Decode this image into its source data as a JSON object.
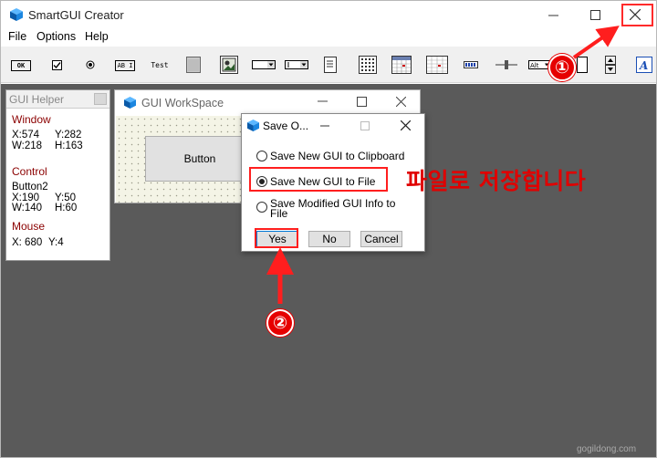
{
  "app": {
    "title": "SmartGUI Creator",
    "close_glyph": "✕",
    "minimize_glyph": "—",
    "maximize_glyph": "☐"
  },
  "menu": [
    "File",
    "Options",
    "Help"
  ],
  "toolbar": {
    "ok_label": "OK",
    "abi_label": "AB I",
    "test_label": "Test",
    "alt_label": "Alt"
  },
  "helper": {
    "title": "GUI Helper",
    "window": {
      "heading": "Window",
      "x": "X:574",
      "y": "Y:282",
      "w": "W:218",
      "h": "H:163"
    },
    "control": {
      "heading": "Control",
      "name": "Button2",
      "x": "X:190",
      "y": "Y:50",
      "w": "W:140",
      "h": "H:60"
    },
    "mouse": {
      "heading": "Mouse",
      "x": "X: 680",
      "y": "Y:4"
    }
  },
  "workspace_window": {
    "title": "GUI WorkSpace",
    "button_label": "Button"
  },
  "dialog": {
    "title": "Save O...",
    "options": [
      {
        "label": "Save New GUI to Clipboard",
        "selected": false
      },
      {
        "label": "Save New GUI to File",
        "selected": true
      },
      {
        "label": "Save Modified GUI Info to File",
        "selected": false
      }
    ],
    "buttons": {
      "yes": "Yes",
      "no": "No",
      "cancel": "Cancel"
    }
  },
  "annotations": {
    "korean_text": "파일로 저장합니다",
    "badge_1": "①",
    "badge_2": "②",
    "highlight_color": "#ff1e1e"
  },
  "watermark": "gogildong.com"
}
